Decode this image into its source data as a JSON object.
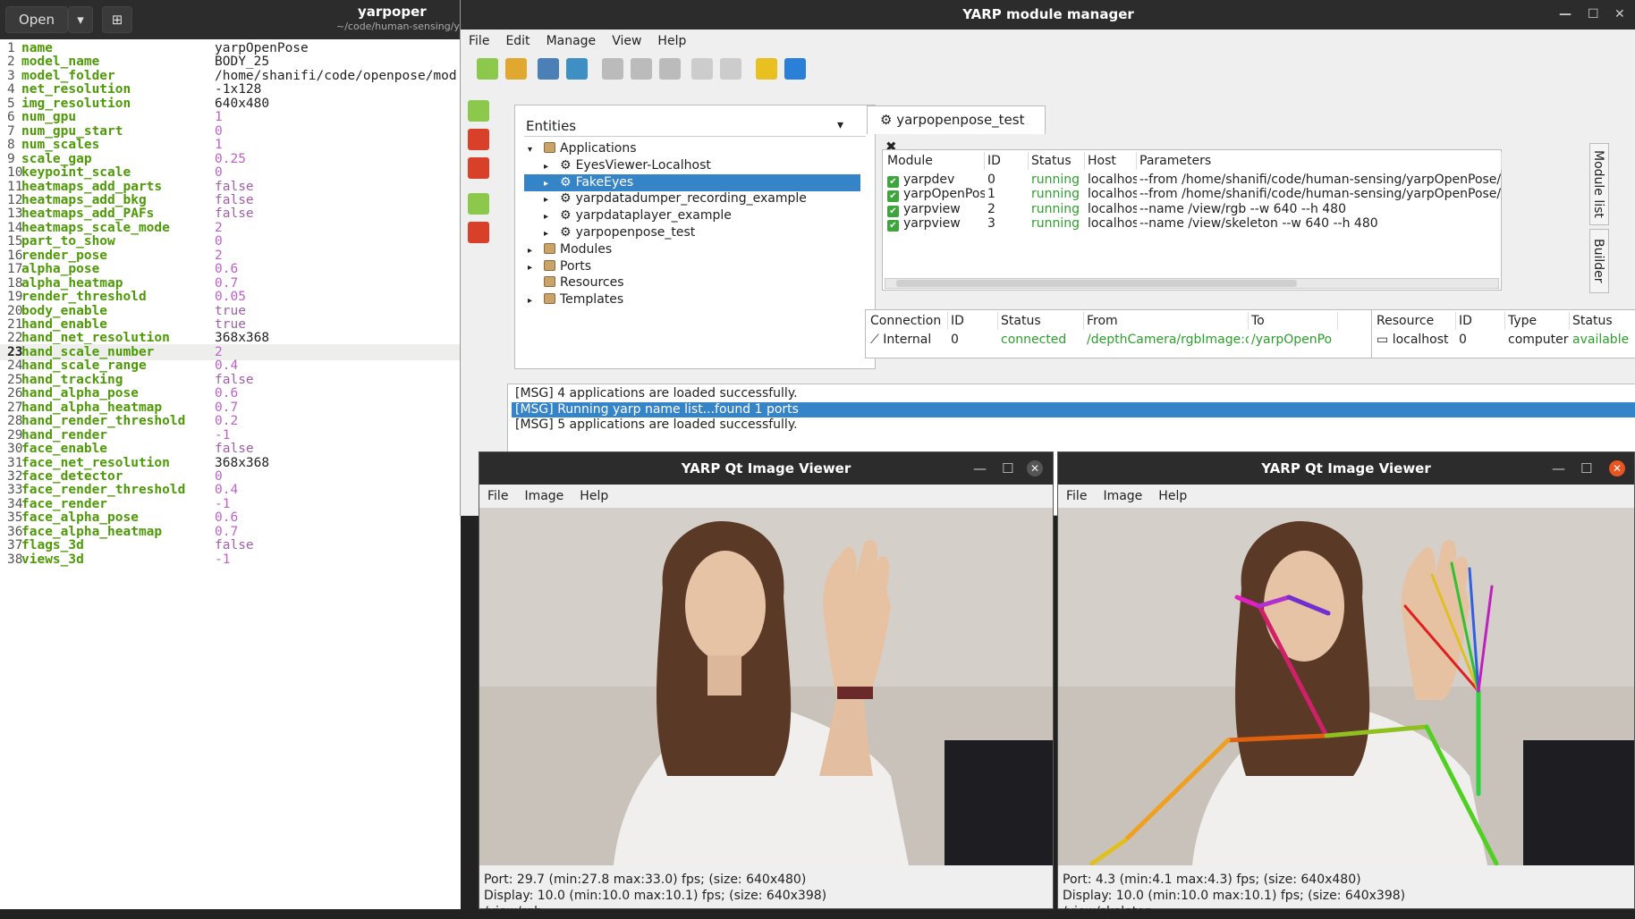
{
  "gedit": {
    "open_label": "Open",
    "title": "yarpoper",
    "subtitle": "~/code/human-sensing/y",
    "current_line": 23,
    "lines": [
      {
        "n": "1",
        "key": "name",
        "val": "yarpOpenPose",
        "kind": "str"
      },
      {
        "n": "2",
        "key": "model_name",
        "val": "BODY_25",
        "kind": "str"
      },
      {
        "n": "3",
        "key": "model_folder",
        "val": "/home/shanifi/code/openpose/mod",
        "kind": "str"
      },
      {
        "n": "4",
        "key": "net_resolution",
        "val": "-1x128",
        "kind": "str"
      },
      {
        "n": "5",
        "key": "img_resolution",
        "val": "640x480",
        "kind": "str"
      },
      {
        "n": "6",
        "key": "num_gpu",
        "val": "1",
        "kind": "num"
      },
      {
        "n": "7",
        "key": "num_gpu_start",
        "val": "0",
        "kind": "num"
      },
      {
        "n": "8",
        "key": "num_scales",
        "val": "1",
        "kind": "num"
      },
      {
        "n": "9",
        "key": "scale_gap",
        "val": "0.25",
        "kind": "num"
      },
      {
        "n": "10",
        "key": "keypoint_scale",
        "val": "0",
        "kind": "num"
      },
      {
        "n": "11",
        "key": "heatmaps_add_parts",
        "val": "false",
        "kind": "bool"
      },
      {
        "n": "12",
        "key": "heatmaps_add_bkg",
        "val": "false",
        "kind": "bool"
      },
      {
        "n": "13",
        "key": "heatmaps_add_PAFs",
        "val": "false",
        "kind": "bool"
      },
      {
        "n": "14",
        "key": "heatmaps_scale_mode",
        "val": "2",
        "kind": "num"
      },
      {
        "n": "15",
        "key": "part_to_show",
        "val": "0",
        "kind": "num"
      },
      {
        "n": "16",
        "key": "render_pose",
        "val": "2",
        "kind": "num"
      },
      {
        "n": "17",
        "key": "alpha_pose",
        "val": "0.6",
        "kind": "num"
      },
      {
        "n": "18",
        "key": "alpha_heatmap",
        "val": "0.7",
        "kind": "num"
      },
      {
        "n": "19",
        "key": "render_threshold",
        "val": "0.05",
        "kind": "num"
      },
      {
        "n": "20",
        "key": "body_enable",
        "val": "true",
        "kind": "bool"
      },
      {
        "n": "21",
        "key": "hand_enable",
        "val": "true",
        "kind": "bool"
      },
      {
        "n": "22",
        "key": "hand_net_resolution",
        "val": "368x368",
        "kind": "str"
      },
      {
        "n": "23",
        "key": "hand_scale_number",
        "val": "2",
        "kind": "num"
      },
      {
        "n": "24",
        "key": "hand_scale_range",
        "val": "0.4",
        "kind": "num"
      },
      {
        "n": "25",
        "key": "hand_tracking",
        "val": "false",
        "kind": "bool"
      },
      {
        "n": "26",
        "key": "hand_alpha_pose",
        "val": "0.6",
        "kind": "num"
      },
      {
        "n": "27",
        "key": "hand_alpha_heatmap",
        "val": "0.7",
        "kind": "num"
      },
      {
        "n": "28",
        "key": "hand_render_threshold",
        "val": "0.2",
        "kind": "num"
      },
      {
        "n": "29",
        "key": "hand_render",
        "val": "-1",
        "kind": "num"
      },
      {
        "n": "30",
        "key": "face_enable",
        "val": "false",
        "kind": "bool"
      },
      {
        "n": "31",
        "key": "face_net_resolution",
        "val": "368x368",
        "kind": "str"
      },
      {
        "n": "32",
        "key": "face_detector",
        "val": "0",
        "kind": "num"
      },
      {
        "n": "33",
        "key": "face_render_threshold",
        "val": "0.4",
        "kind": "num"
      },
      {
        "n": "34",
        "key": "face_render",
        "val": "-1",
        "kind": "num"
      },
      {
        "n": "35",
        "key": "face_alpha_pose",
        "val": "0.6",
        "kind": "num"
      },
      {
        "n": "36",
        "key": "face_alpha_heatmap",
        "val": "0.7",
        "kind": "num"
      },
      {
        "n": "37",
        "key": "flags_3d",
        "val": "false",
        "kind": "bool"
      },
      {
        "n": "38",
        "key": "views_3d",
        "val": "-1",
        "kind": "num"
      }
    ]
  },
  "manager": {
    "title": "YARP module manager",
    "menu": [
      "File",
      "Edit",
      "Manage",
      "View",
      "Help"
    ],
    "entities_label": "Entities",
    "tree": [
      {
        "label": "Applications",
        "depth": 0,
        "arrow": "▾",
        "icon": "folder-icon"
      },
      {
        "label": "EyesViewer-Localhost",
        "depth": 1,
        "arrow": "▸",
        "icon": "gear-icon"
      },
      {
        "label": "FakeEyes",
        "depth": 1,
        "arrow": "▸",
        "icon": "gear-icon",
        "selected": true
      },
      {
        "label": "yarpdatadumper_recording_example",
        "depth": 1,
        "arrow": "▸",
        "icon": "gear-icon"
      },
      {
        "label": "yarpdataplayer_example",
        "depth": 1,
        "arrow": "▸",
        "icon": "gear-icon"
      },
      {
        "label": "yarpopenpose_test",
        "depth": 1,
        "arrow": "▸",
        "icon": "gear-icon"
      },
      {
        "label": "Modules",
        "depth": 0,
        "arrow": "▸",
        "icon": "folder-icon"
      },
      {
        "label": "Ports",
        "depth": 0,
        "arrow": "▸",
        "icon": "folder-icon"
      },
      {
        "label": "Resources",
        "depth": 0,
        "arrow": "",
        "icon": "folder-icon"
      },
      {
        "label": "Templates",
        "depth": 0,
        "arrow": "▸",
        "icon": "folder-icon"
      }
    ],
    "app_tab": "yarpopenpose_test",
    "module_headers": [
      "Module",
      "ID",
      "Status",
      "Host",
      "Parameters"
    ],
    "modules": [
      {
        "module": "yarpdev",
        "id": "0",
        "status": "running",
        "host": "localhost",
        "params": "--from /home/shanifi/code/human-sensing/yarpOpenPose/app/co"
      },
      {
        "module": "yarpOpenPose",
        "id": "1",
        "status": "running",
        "host": "localhost",
        "params": "--from /home/shanifi/code/human-sensing/yarpOpenPose/app/co"
      },
      {
        "module": "yarpview",
        "id": "2",
        "status": "running",
        "host": "localhost",
        "params": "--name /view/rgb --w 640 --h 480"
      },
      {
        "module": "yarpview",
        "id": "3",
        "status": "running",
        "host": "localhost",
        "params": "--name /view/skeleton --w 640 --h 480"
      }
    ],
    "conn_headers": [
      "Connection",
      "ID",
      "Status",
      "From",
      "To"
    ],
    "connections": [
      {
        "type": "Internal",
        "id": "0",
        "status": "connected",
        "from": "/depthCamera/rgbImage:o",
        "to": "/yarpOpenPo"
      }
    ],
    "res_headers": [
      "Resource",
      "ID",
      "Type",
      "Status"
    ],
    "resources": [
      {
        "resource": "localhost",
        "id": "0",
        "type": "computer",
        "status": "available"
      }
    ],
    "vtabs": [
      "Module list",
      "Builder"
    ],
    "messages": [
      {
        "text": "[MSG] 4 applications are loaded successfully."
      },
      {
        "text": "[MSG] Running yarp name list...found 1 ports",
        "selected": true
      },
      {
        "text": "[MSG] 5 applications are loaded successfully."
      }
    ]
  },
  "viewer_rgb": {
    "title": "YARP Qt Image Viewer",
    "menu": [
      "File",
      "Image",
      "Help"
    ],
    "port": "Port: 29.7 (min:27.8 max:33.0) fps; (size: 640x480)",
    "display": "Display: 10.0 (min:10.0 max:10.1) fps; (size: 640x398)",
    "name": "/view/rgb"
  },
  "viewer_skel": {
    "title": "YARP Qt Image Viewer",
    "menu": [
      "File",
      "Image",
      "Help"
    ],
    "port": "Port: 4.3 (min:4.1 max:4.3) fps; (size: 640x480)",
    "display": "Display: 10.0 (min:10.0 max:10.1) fps; (size: 640x398)",
    "name": "/view/skeleton"
  },
  "colors": {
    "accent": "#3584c8",
    "running": "#2c9e2c",
    "key": "#4e9a06",
    "number": "#c061cb"
  }
}
